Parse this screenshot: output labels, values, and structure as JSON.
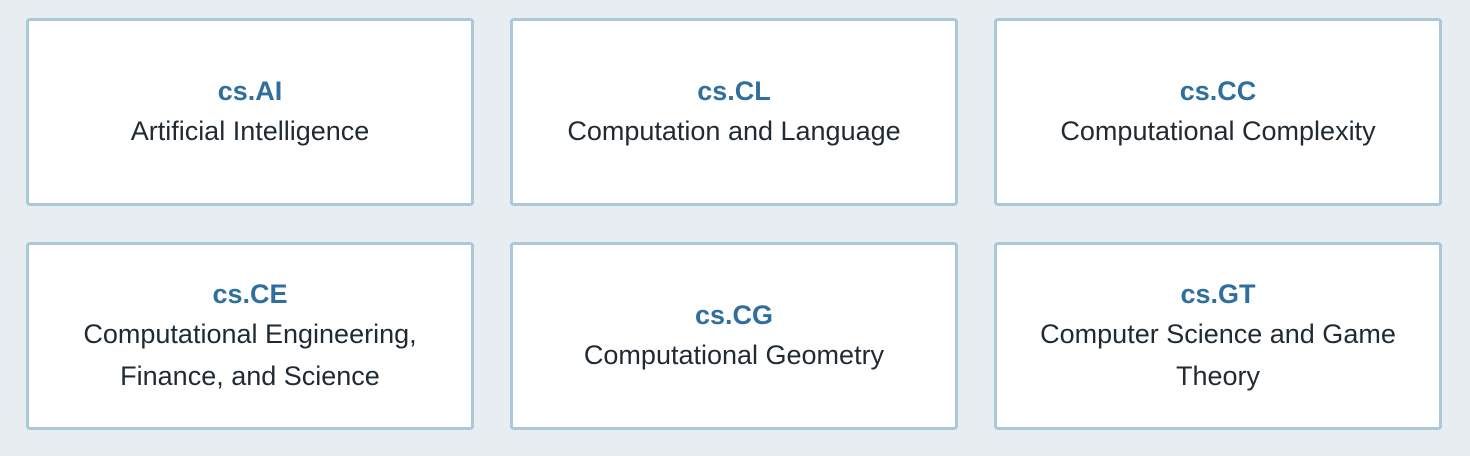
{
  "categories": [
    {
      "code": "cs.AI",
      "name": "Artificial Intelligence"
    },
    {
      "code": "cs.CL",
      "name": "Computation and Language"
    },
    {
      "code": "cs.CC",
      "name": "Computational Complexity"
    },
    {
      "code": "cs.CE",
      "name": "Computational Engineering, Finance, and Science"
    },
    {
      "code": "cs.CG",
      "name": "Computational Geometry"
    },
    {
      "code": "cs.GT",
      "name": "Computer Science and Game Theory"
    }
  ],
  "colors": {
    "background": "#e8edf1",
    "card_background": "#ffffff",
    "card_border": "#a9c8da",
    "code_text": "#2e6f9e",
    "name_text": "#1f2a33"
  }
}
